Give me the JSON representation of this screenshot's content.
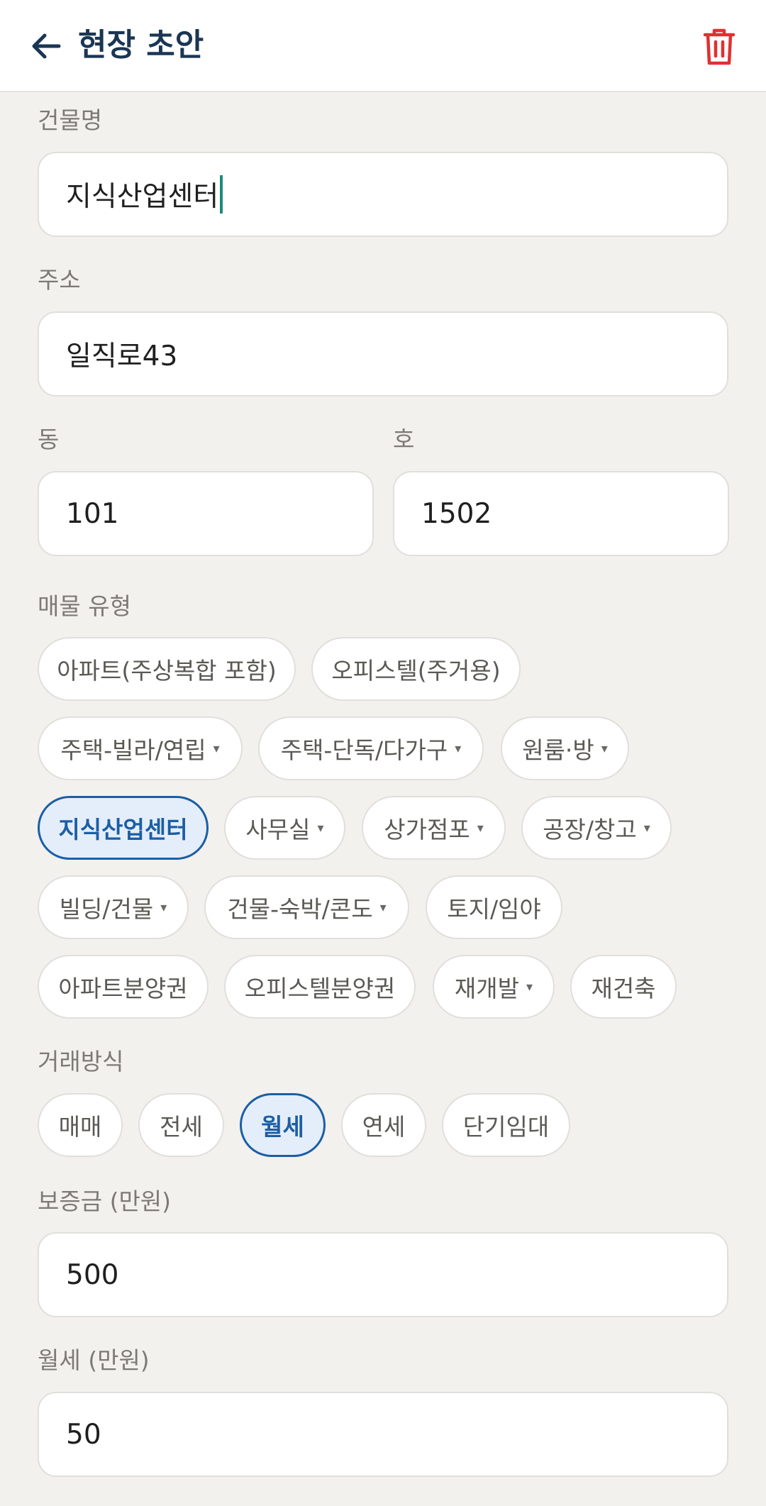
{
  "header": {
    "title": "현장 초안",
    "back_icon": "arrow-left-icon",
    "delete_icon": "trash-icon",
    "accent": "#1b3654",
    "delete_color": "#e03030"
  },
  "building": {
    "label": "건물명",
    "value": "지식산업센터"
  },
  "address": {
    "label": "주소",
    "value": "일직로43"
  },
  "dong": {
    "label": "동",
    "value": "101"
  },
  "ho": {
    "label": "호",
    "value": "1502"
  },
  "property_type": {
    "label": "매물 유형",
    "selected": "지식산업센터",
    "chips": [
      {
        "label": "아파트(주상복합 포함)",
        "dropdown": false
      },
      {
        "label": "오피스텔(주거용)",
        "dropdown": false
      },
      {
        "label": "주택-빌라/연립",
        "dropdown": true
      },
      {
        "label": "주택-단독/다가구",
        "dropdown": true
      },
      {
        "label": "원룸·방",
        "dropdown": true
      },
      {
        "label": "지식산업센터",
        "dropdown": false
      },
      {
        "label": "사무실",
        "dropdown": true
      },
      {
        "label": "상가점포",
        "dropdown": true
      },
      {
        "label": "공장/창고",
        "dropdown": true
      },
      {
        "label": "빌딩/건물",
        "dropdown": true
      },
      {
        "label": "건물-숙박/콘도",
        "dropdown": true
      },
      {
        "label": "토지/임야",
        "dropdown": false
      },
      {
        "label": "아파트분양권",
        "dropdown": false
      },
      {
        "label": "오피스텔분양권",
        "dropdown": false
      },
      {
        "label": "재개발",
        "dropdown": true
      },
      {
        "label": "재건축",
        "dropdown": false
      }
    ],
    "caret": "▾"
  },
  "deal_type": {
    "label": "거래방식",
    "selected": "월세",
    "chips": [
      {
        "label": "매매"
      },
      {
        "label": "전세"
      },
      {
        "label": "월세"
      },
      {
        "label": "연세"
      },
      {
        "label": "단기임대"
      }
    ]
  },
  "deposit": {
    "label": "보증금 (만원)",
    "value": "500"
  },
  "monthly_rent": {
    "label": "월세 (만원)",
    "value": "50"
  },
  "colors": {
    "selected_chip": "#1c5ea5",
    "cursor": "#1a8a82"
  }
}
